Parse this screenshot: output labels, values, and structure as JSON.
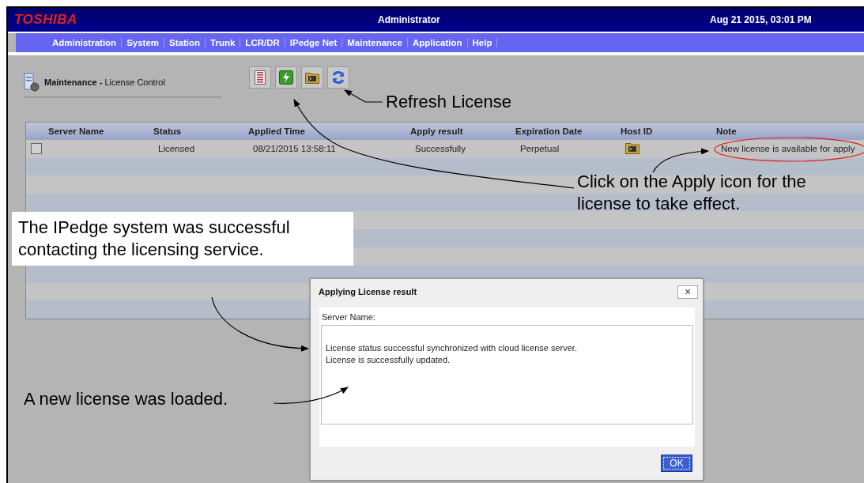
{
  "header": {
    "logo": "TOSHIBA",
    "user": "Administrator",
    "datetime": "Aug 21 2015, 03:01 PM"
  },
  "menu": [
    {
      "label": "Administration",
      "selected": false
    },
    {
      "label": "System",
      "selected": false
    },
    {
      "label": "Station",
      "selected": false
    },
    {
      "label": "Trunk",
      "selected": false
    },
    {
      "label": "LCR/DR",
      "selected": false
    },
    {
      "label": "IPedge Net",
      "selected": false
    },
    {
      "label": "Maintenance",
      "selected": false
    },
    {
      "label": "Application",
      "selected": false
    },
    {
      "label": "Help",
      "selected": false
    }
  ],
  "page": {
    "section": "Maintenance",
    "separator": "-",
    "title": "License Control"
  },
  "toolbar": [
    {
      "kind": "list"
    },
    {
      "kind": "apply"
    },
    {
      "kind": "console"
    },
    {
      "kind": "refresh"
    }
  ],
  "table": {
    "columns": [
      "Server Name",
      "Status",
      "Applied Time",
      "Apply result",
      "Expiration Date",
      "Host ID",
      "Note"
    ],
    "rows": [
      {
        "checked": false,
        "status": "Licensed",
        "applied_time": "08/21/2015 13:58:11",
        "apply_result": "Successfully",
        "expiration_date": "Perpetual",
        "host_id": {
          "kind": "console"
        },
        "note": "New license is available for apply"
      }
    ]
  },
  "dialog": {
    "title": "Applying License result",
    "close": "×",
    "label": "Server Name:",
    "messages": [
      "License status successful synchronized with cloud license server.",
      "License is successfully updated."
    ],
    "ok": "OK"
  },
  "annotations": {
    "refresh": "Refresh License",
    "apply": "Click on the Apply icon for the license to take effect.",
    "success": "The IPedge system was successful contacting the licensing service.",
    "loaded": "A new license was loaded."
  }
}
